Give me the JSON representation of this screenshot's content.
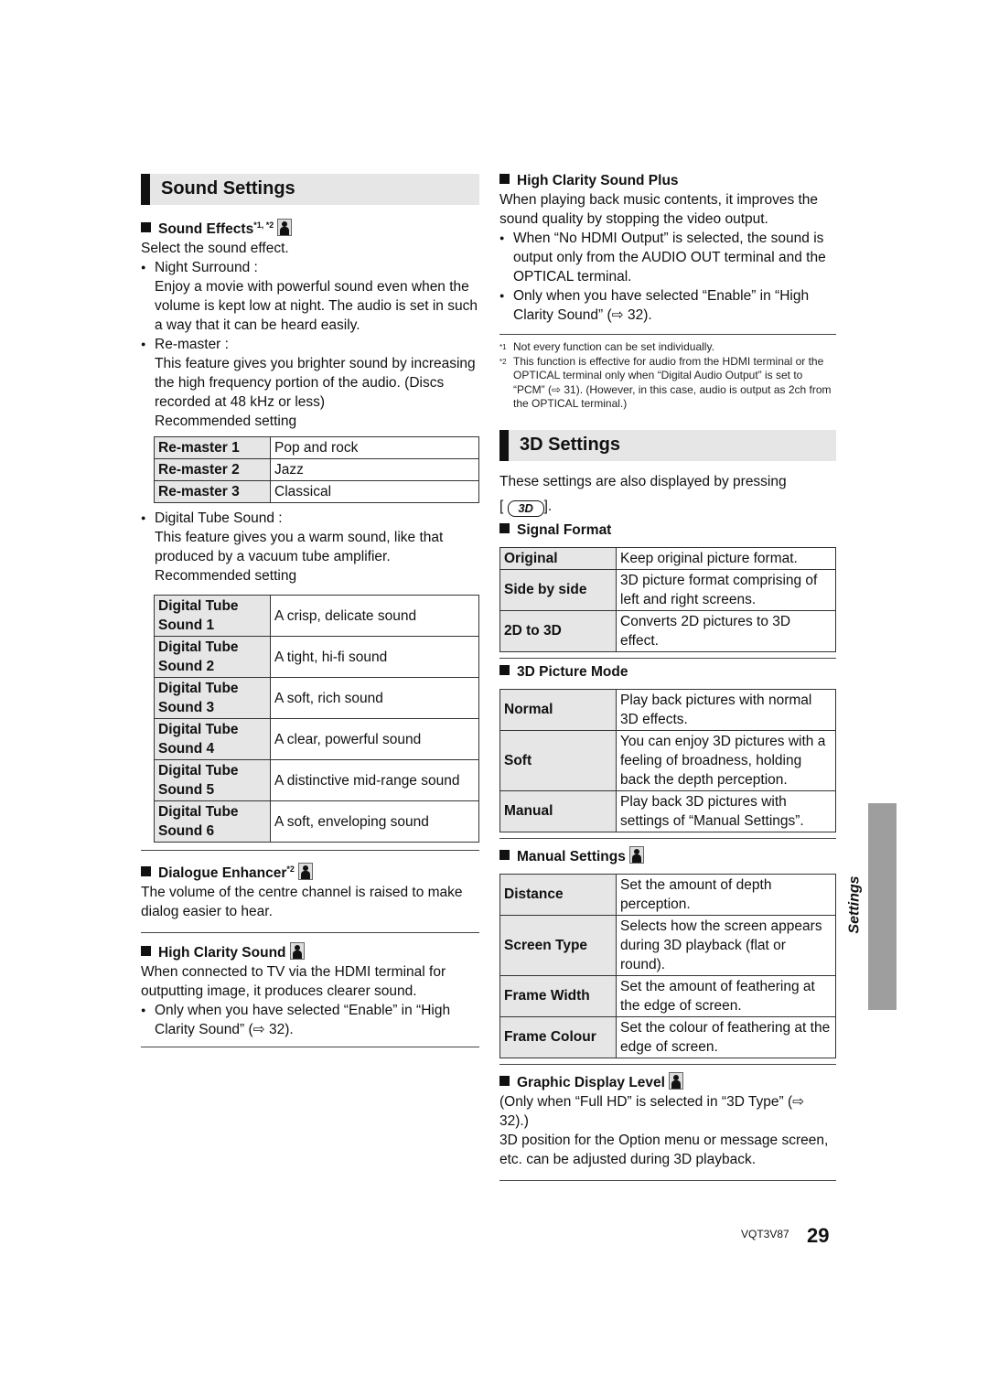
{
  "sound_settings": {
    "title": "Sound Settings",
    "sound_effects": {
      "heading": "Sound Effects",
      "sup": "*1, *2",
      "intro": "Select the sound effect.",
      "night_surround_label": "Night Surround :",
      "night_surround_text": "Enjoy a movie with powerful sound even when the volume is kept low at night. The audio is set in such a way that it can be heard easily.",
      "remaster_label": "Re-master :",
      "remaster_text": "This feature gives you brighter sound by increasing the high frequency portion of the audio. (Discs recorded at 48 kHz or less)",
      "recommended": "Recommended setting",
      "remaster_table": [
        {
          "key": "Re-master 1",
          "value": "Pop and rock"
        },
        {
          "key": "Re-master 2",
          "value": "Jazz"
        },
        {
          "key": "Re-master 3",
          "value": "Classical"
        }
      ],
      "tube_label": "Digital Tube Sound :",
      "tube_text": "This feature gives you a warm sound, like that produced by a vacuum tube amplifier.",
      "tube_recommended": "Recommended setting",
      "tube_table": [
        {
          "key": "Digital Tube Sound 1",
          "value": "A crisp, delicate sound"
        },
        {
          "key": "Digital Tube Sound 2",
          "value": "A tight, hi-fi sound"
        },
        {
          "key": "Digital Tube Sound 3",
          "value": "A soft, rich sound"
        },
        {
          "key": "Digital Tube Sound 4",
          "value": "A clear, powerful sound"
        },
        {
          "key": "Digital Tube Sound 5",
          "value": "A distinctive mid-range sound"
        },
        {
          "key": "Digital Tube Sound 6",
          "value": "A soft, enveloping sound"
        }
      ]
    },
    "dialogue_enhancer": {
      "heading": "Dialogue Enhancer",
      "sup": "*2",
      "text": "The volume of the centre channel is raised to make dialog easier to hear."
    },
    "high_clarity_sound": {
      "heading": "High Clarity Sound",
      "text": "When connected to TV via the HDMI terminal for outputting image, it produces clearer sound.",
      "bullet": "Only when you have selected “Enable” in “High Clarity Sound” (⇨ 32)."
    },
    "high_clarity_sound_plus": {
      "heading": "High Clarity Sound Plus",
      "text": "When playing back music contents, it improves the sound quality by stopping the video output.",
      "bullets": [
        "When “No HDMI Output” is selected, the sound is output only from the AUDIO OUT terminal and the OPTICAL terminal.",
        "Only when you have selected “Enable” in “High Clarity Sound” (⇨ 32)."
      ]
    },
    "footnotes": [
      {
        "mark": "*1",
        "text": "Not every function can be set individually."
      },
      {
        "mark": "*2",
        "text": "This function is effective for audio from the HDMI terminal or the OPTICAL terminal only when “Digital Audio Output” is set to “PCM” (⇨ 31). (However, in this case, audio is output as 2ch from the OPTICAL terminal.)"
      }
    ]
  },
  "settings_3d": {
    "title": "3D Settings",
    "intro": "These settings are also displayed by pressing",
    "key_label": "3D",
    "signal_format": {
      "heading": "Signal Format",
      "table": [
        {
          "key": "Original",
          "value": "Keep original picture format."
        },
        {
          "key": "Side by side",
          "value": "3D picture format comprising of left and right screens."
        },
        {
          "key": "2D to 3D",
          "value": "Converts 2D pictures to 3D effect."
        }
      ]
    },
    "picture_mode": {
      "heading": "3D Picture Mode",
      "table": [
        {
          "key": "Normal",
          "value": "Play back pictures with normal 3D effects."
        },
        {
          "key": "Soft",
          "value": "You can enjoy 3D pictures with a feeling of broadness, holding back the depth perception."
        },
        {
          "key": "Manual",
          "value": "Play back 3D pictures with settings of “Manual Settings”."
        }
      ]
    },
    "manual_settings": {
      "heading": "Manual Settings",
      "table": [
        {
          "key": "Distance",
          "value": "Set the amount of depth perception."
        },
        {
          "key": "Screen Type",
          "value": "Selects how the screen appears during 3D playback (flat or round)."
        },
        {
          "key": "Frame Width",
          "value": "Set the amount of feathering at the edge of screen."
        },
        {
          "key": "Frame Colour",
          "value": "Set the colour of feathering at the edge of screen."
        }
      ]
    },
    "graphic_display_level": {
      "heading": "Graphic Display Level",
      "note": "(Only when “Full HD” is selected in “3D Type” (⇨ 32).)",
      "text": "3D position for the Option menu or message screen, etc. can be adjusted during 3D playback."
    }
  },
  "side_tab": {
    "label": "Settings"
  },
  "footer": {
    "code": "VQT3V87",
    "page": "29"
  }
}
